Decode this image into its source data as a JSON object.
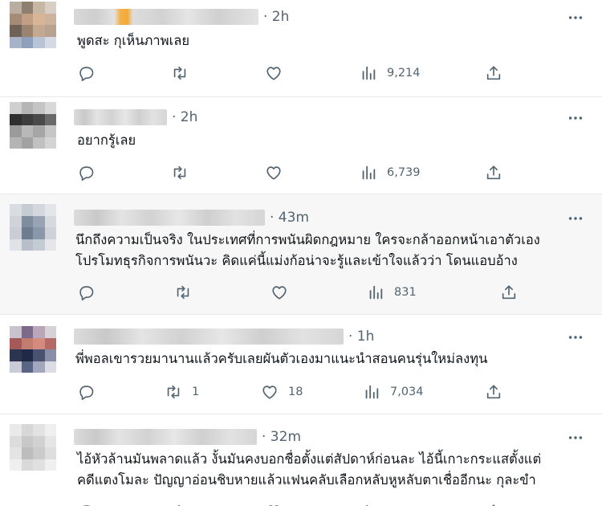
{
  "colors": {
    "icon": "#536471",
    "text": "#0f1419",
    "divider": "#e7e9ea",
    "highlight_bg": "#f7f7f7",
    "name_accent": "#f5a934"
  },
  "icons": {
    "reply": "reply-icon",
    "retweet": "retweet-icon",
    "like": "like-icon",
    "views": "views-icon",
    "share": "share-icon",
    "more": "more-icon"
  },
  "tweets": [
    {
      "time": "· 2h",
      "lines": [
        "พูดสะ กุเห็นภาพเลย"
      ],
      "retweets": "",
      "likes": "",
      "views": "9,214"
    },
    {
      "time": "· 2h",
      "lines": [
        "อยากรู้เลย"
      ],
      "retweets": "",
      "likes": "",
      "views": "6,739"
    },
    {
      "time": "· 43m",
      "lines": [
        "นึกถึงความเป็นจริง ในประเทศที่การพนันผิดกฎหมาย ใครจะกล้าออกหน้าเอาตัวเอง",
        "โปรโมทธุรกิจการพนันวะ คิดแค่นี้แม่งก้อน่าจะรู้และเข้าใจแล้วว่า โดนแอบอ้าง"
      ],
      "retweets": "",
      "likes": "",
      "views": "831"
    },
    {
      "time": "· 1h",
      "lines": [
        "พี่พอลเขารวยมานานแล้วครับเลยผันตัวเองมาแนะนำสอนคนรุ่นใหม่ลงทุน"
      ],
      "retweets": "1",
      "likes": "18",
      "views": "7,034"
    },
    {
      "time": "· 32m",
      "lines": [
        "ไอ้หัวล้านมันพลาดแล้ว งั้นมันคงบอกชื่อตั้งแต่สัปดาห์ก่อนละ ไอ้นี้เกาะกระแสตั้งแต่",
        "คดีแตงโมละ ปัญญาอ่อนชิบหายแล้วแฟนคลับเลือกหลับหูหลับตาเชื่ออีกนะ กุละขำ"
      ],
      "retweets": "",
      "likes": "",
      "views": ""
    }
  ]
}
